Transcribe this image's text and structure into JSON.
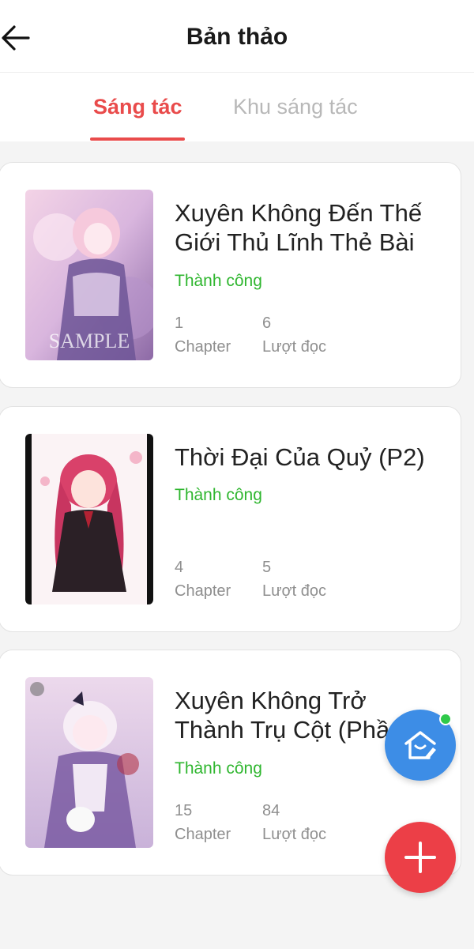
{
  "header": {
    "title": "Bản thảo",
    "back_icon": "arrow-left-icon"
  },
  "tabs": [
    {
      "label": "Sáng tác",
      "active": true
    },
    {
      "label": "Khu sáng tác",
      "active": false
    }
  ],
  "colors": {
    "accent": "#e94b4b",
    "status_success": "#2fb62f",
    "fab_home": "#3d8de6",
    "fab_add": "#ec3f47",
    "online_dot": "#2fc94a"
  },
  "works": [
    {
      "title_lines": [
        "Xuyên Không Đến Thế",
        "Giới Thủ Lĩnh Thẻ Bài"
      ],
      "status": "Thành công",
      "chapters": "1",
      "chapters_label": "Chapter",
      "reads": "6",
      "reads_label": "Lượt đọc",
      "cover_watermark": "SAMPLE"
    },
    {
      "title_lines": [
        "Thời Đại Của Quỷ (P2)"
      ],
      "status": "Thành công",
      "chapters": "4",
      "chapters_label": "Chapter",
      "reads": "5",
      "reads_label": "Lượt đọc"
    },
    {
      "title_lines": [
        "Xuyên Không Trở",
        "Thành Trụ Cột (Phần"
      ],
      "status": "Thành công",
      "chapters": "15",
      "chapters_label": "Chapter",
      "reads": "84",
      "reads_label": "Lượt đọc"
    }
  ],
  "fabs": {
    "home_icon": "home-edit-icon",
    "add_icon": "plus-icon"
  }
}
